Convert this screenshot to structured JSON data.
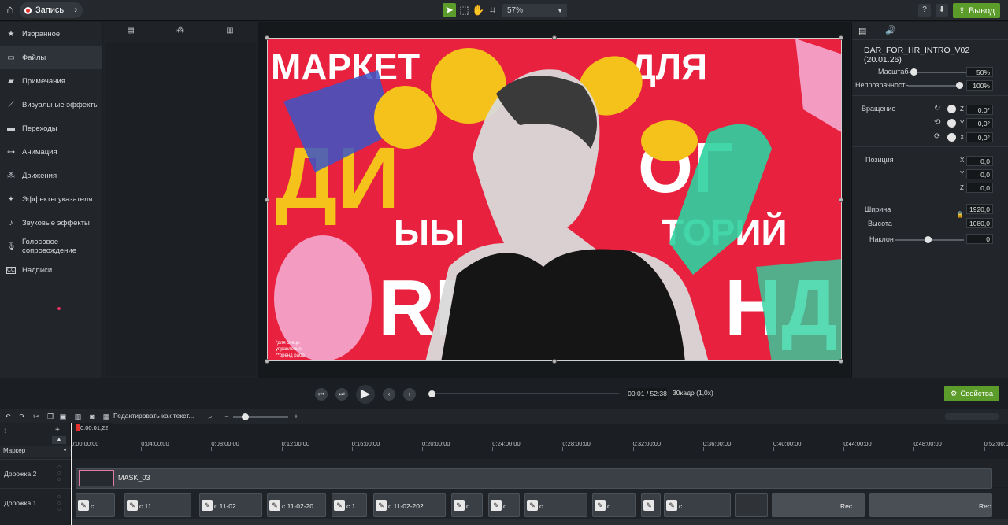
{
  "topbar": {
    "record_label": "Запись",
    "zoom_value": "57%",
    "export_label": "Вывод"
  },
  "sidebar": {
    "items": [
      {
        "label": "Избранное",
        "icon": "star-icon"
      },
      {
        "label": "Файлы",
        "icon": "media-icon"
      },
      {
        "label": "Примечания",
        "icon": "annotation-icon"
      },
      {
        "label": "Визуальные эффекты",
        "icon": "wand-icon"
      },
      {
        "label": "Переходы",
        "icon": "transition-icon"
      },
      {
        "label": "Анимация",
        "icon": "animation-icon"
      },
      {
        "label": "Движения",
        "icon": "motion-icon"
      },
      {
        "label": "Эффекты указателя",
        "icon": "cursor-effects-icon"
      },
      {
        "label": "Звуковые эффекты",
        "icon": "audio-effects-icon"
      },
      {
        "label": "Голосовое сопровождение",
        "icon": "microphone-icon"
      },
      {
        "label": "Надписи",
        "icon": "captions-icon"
      }
    ]
  },
  "properties": {
    "title": "DAR_FOR_HR_INTRO_V02 (20.01.26)",
    "scale_label": "Масштаб",
    "scale_value": "50%",
    "opacity_label": "Непрозрачность",
    "opacity_value": "100%",
    "rotation_label": "Вращение",
    "rot_z": "0,0°",
    "rot_y": "0,0°",
    "rot_x": "0,0°",
    "position_label": "Позиция",
    "pos_x": "0,0",
    "pos_y": "0,0",
    "pos_z": "0,0",
    "width_label": "Ширина",
    "width_value": "1920,0",
    "height_label": "Высота",
    "height_value": "1080,0",
    "skew_label": "Наклон",
    "skew_value": "0",
    "axis_x": "X",
    "axis_y": "Y",
    "axis_z": "Z"
  },
  "canvas": {
    "line1": "МАРКЕТ",
    "line1b": "ДЛЯ",
    "line2": "ДИ",
    "line2b": "ОГ",
    "line3": "ЫЫ",
    "line3b": "ТОРИЙ",
    "line4": "RЕ",
    "line4b": "НД",
    "footnote1": "*для специ",
    "footnote2": "управления",
    "footnote3": "**бренд рабо"
  },
  "transport": {
    "timecode": "00:01 / 52:38",
    "fps": "30кадр (1,0x)",
    "properties_label": "Свойства"
  },
  "timeline": {
    "edit_label": "Редактировать как текст...",
    "playhead_time": "0:00:01;22",
    "marker_label": "Маркер",
    "ticks": [
      "0:00:00;00",
      "0:04:00;00",
      "0:08:00;00",
      "0:12:00;00",
      "0:16:00;00",
      "0:20:00;00",
      "0:24:00;00",
      "0:28:00;00",
      "0:32:00;00",
      "0:36:00;00",
      "0:40:00;00",
      "0:44:00;00",
      "0:48:00;00",
      "0:52:00;00"
    ],
    "tracks": [
      {
        "label": "Дорожка 2"
      },
      {
        "label": "Дорожка 1"
      }
    ],
    "mask_clip": "MASK_03",
    "clips": [
      "с",
      "с 11",
      "с 11-02",
      "с 11-02-20",
      "с 1",
      "с 11-02-202",
      "с",
      "с",
      "с",
      "с",
      "с",
      "Rec",
      "Rec"
    ]
  },
  "colors": {
    "accent_green": "#5b9c2a",
    "canvas_red": "#e8213f",
    "record_red": "#e0312f"
  }
}
